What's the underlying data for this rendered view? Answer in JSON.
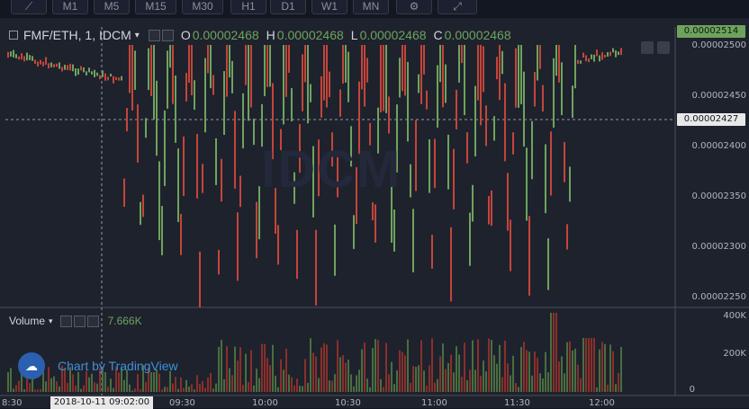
{
  "toolbar": {
    "intervals": [
      "M1",
      "M5",
      "M15",
      "M30",
      "H1",
      "D1",
      "W1",
      "MN"
    ]
  },
  "legend": {
    "symbol": "FMF/ETH, 1, IDCM",
    "open_key": "O",
    "open": "0.00002468",
    "high_key": "H",
    "high": "0.00002468",
    "low_key": "L",
    "low": "0.00002468",
    "close_key": "C",
    "close": "0.00002468"
  },
  "price_axis": {
    "labels": [
      "0.00002500",
      "0.00002450",
      "0.00002400",
      "0.00002350",
      "0.00002300",
      "0.00002250"
    ],
    "last_price": "0.00002514",
    "crosshair_price": "0.00002427"
  },
  "volume": {
    "label": "Volume",
    "value": "7.666K",
    "axis_labels": [
      "400K",
      "200K",
      "0"
    ]
  },
  "time_axis": {
    "labels": [
      "8:30",
      "09:30",
      "10:00",
      "10:30",
      "11:00",
      "11:30",
      "12:00"
    ],
    "crosshair_time": "2018-10-11 09:02:00"
  },
  "watermark": "IDCM",
  "branding": {
    "label": "Chart by TradingView"
  },
  "colors": {
    "up": "#6ea35d",
    "down": "#c4453a",
    "background": "#1e222d",
    "last_price_tag": "#6ea35d"
  }
}
